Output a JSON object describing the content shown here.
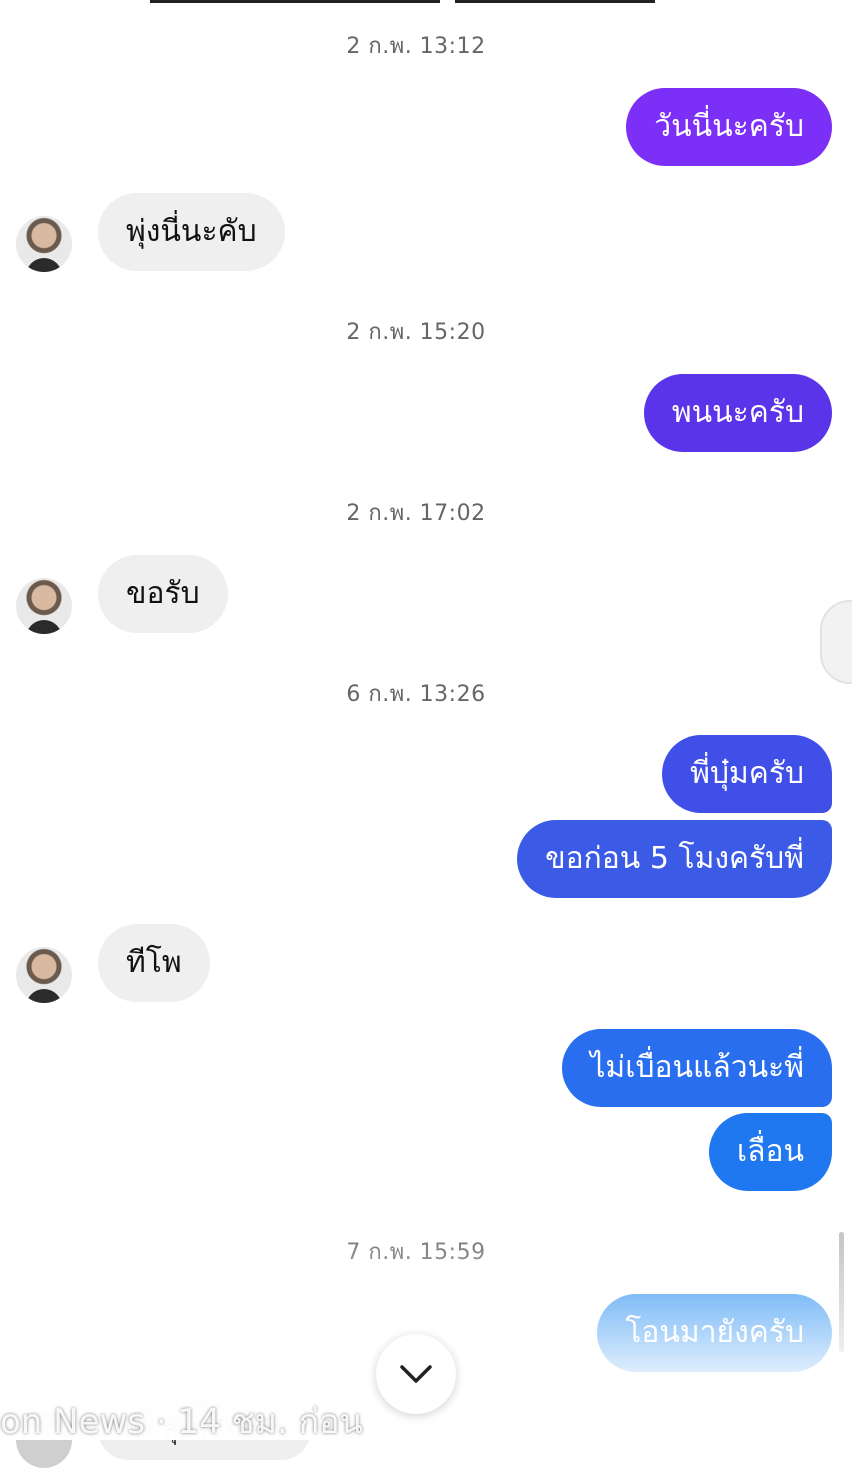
{
  "colors": {
    "incoming_bubble": "#efefef",
    "outgoing_purple": "#7b2ff7",
    "outgoing_indigo": "#5a34e8",
    "outgoing_blue": "#3b5be6",
    "outgoing_lightblue": "#1a86f0"
  },
  "timestamps": [
    "2 ก.พ. 13:12",
    "2 ก.พ. 15:20",
    "2 ก.พ. 17:02",
    "6 ก.พ. 13:26",
    "7 ก.พ. 15:59"
  ],
  "messages": [
    {
      "text": "วันนี่นะครับ",
      "side": "outgoing"
    },
    {
      "text": "พุ่งนี่นะคับ",
      "side": "incoming"
    },
    {
      "text": "พนนะครับ",
      "side": "outgoing"
    },
    {
      "text": "ขอรับ",
      "side": "incoming"
    },
    {
      "text": "พี่บุ๋มครับ",
      "side": "outgoing"
    },
    {
      "text": "ขอก่อน 5 โมงครับพี่",
      "side": "outgoing"
    },
    {
      "text": "ทีโพ",
      "side": "incoming"
    },
    {
      "text": "ไม่เบื่อนแล้วนะพี่",
      "side": "outgoing"
    },
    {
      "text": "เลื่อน",
      "side": "outgoing"
    },
    {
      "text": "โอนมายังครับ",
      "side": "outgoing"
    },
    {
      "text": "นะ ลุงหน่อยล้า",
      "side": "incoming"
    }
  ],
  "scroll_button_icon": "chevron-down-icon",
  "avatar_icon": "avatar",
  "watermark": "on News · 14 ชม. ก่อน"
}
